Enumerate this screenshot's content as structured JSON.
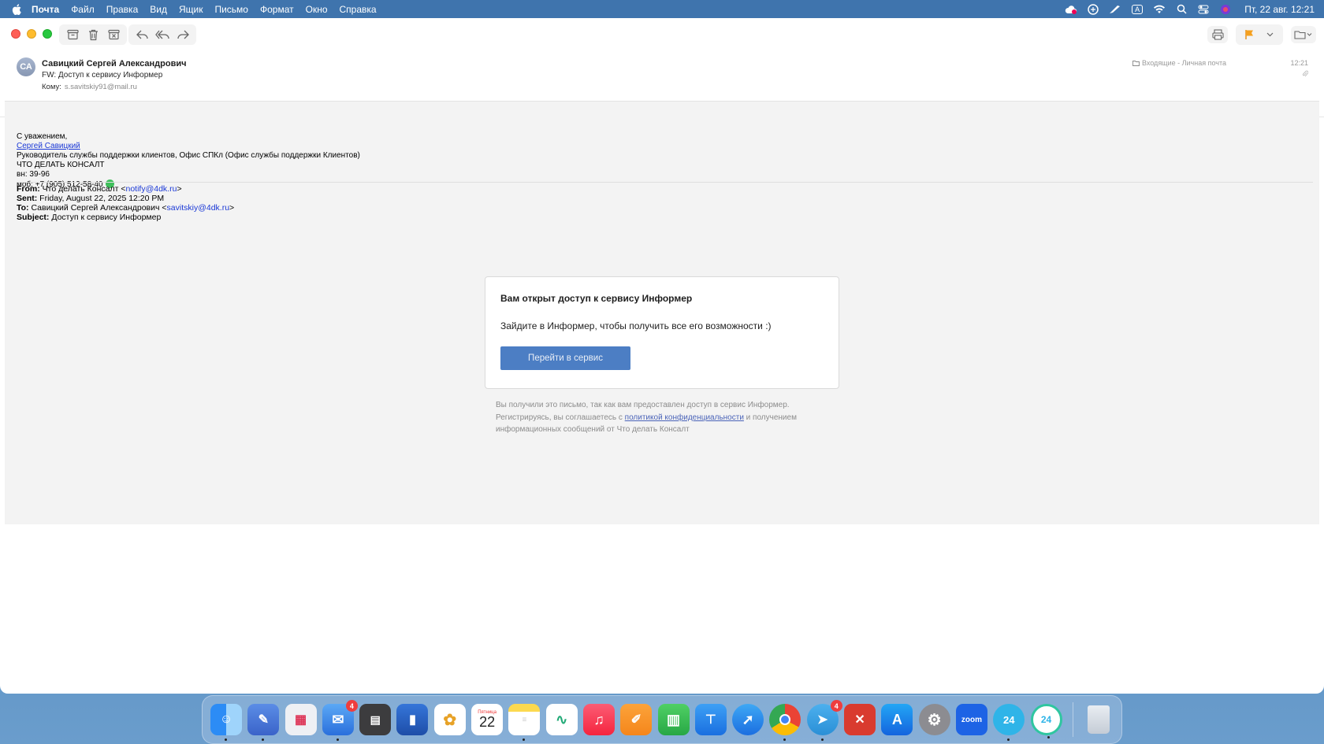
{
  "menubar": {
    "app_name": "Почта",
    "items": [
      "Файл",
      "Правка",
      "Вид",
      "Ящик",
      "Письмо",
      "Формат",
      "Окно",
      "Справка"
    ],
    "clock": "Пт, 22 авг.  12:21",
    "input_indicator": "A"
  },
  "message": {
    "avatar_initials": "СА",
    "sender": "Савицкий Сергей Александрович",
    "subject": "FW: Доступ к сервису Информер",
    "to_label": "Кому:",
    "to_address": "s.savitskiy91@mail.ru",
    "mailbox": "Входящие - Личная почта",
    "time": "12:21"
  },
  "signature": {
    "greeting": "С уважением,",
    "name": "Сергей Савицкий",
    "position": "Руководитель службы поддержки клиентов, Офис СПКл (Офис службы поддержки Клиентов)",
    "company": "ЧТО ДЕЛАТЬ КОНСАЛТ",
    "ext": "вн: 39-96",
    "mobile": "моб: +7 (905) 512-58-40"
  },
  "forwarded": {
    "from_label": "From:",
    "from_name": " Что делать Консалт <",
    "from_email": "notify@4dk.ru",
    "from_end": ">",
    "sent_label": "Sent:",
    "sent_value": " Friday, August 22, 2025 12:20 PM",
    "to_label": "To:",
    "to_name": " Савицкий Сергей Александрович <",
    "to_email": "savitskiy@4dk.ru",
    "to_end": ">",
    "subject_label": "Subject:",
    "subject_value": " Доступ к сервису Информер"
  },
  "card": {
    "title": "Вам открыт доступ к сервису Информер",
    "text": "Зайдите в Информер, чтобы получить все его возможности :)",
    "button": "Перейти в сервис"
  },
  "footnote": {
    "part1": "Вы получили это письмо, так как вам предоставлен доступ в сервис Информер. Регистрируясь, вы соглашаетесь с ",
    "policy_link": "политикой конфиденциальности",
    "part2": " и получением информационных сообщений от Что делать Консалт"
  },
  "dock": {
    "mail_badge": "4",
    "telegram_badge": "4",
    "calendar_day": "22",
    "calendar_weekday": "Пятница",
    "zoom_label": "zoom",
    "b24_label": "24"
  }
}
